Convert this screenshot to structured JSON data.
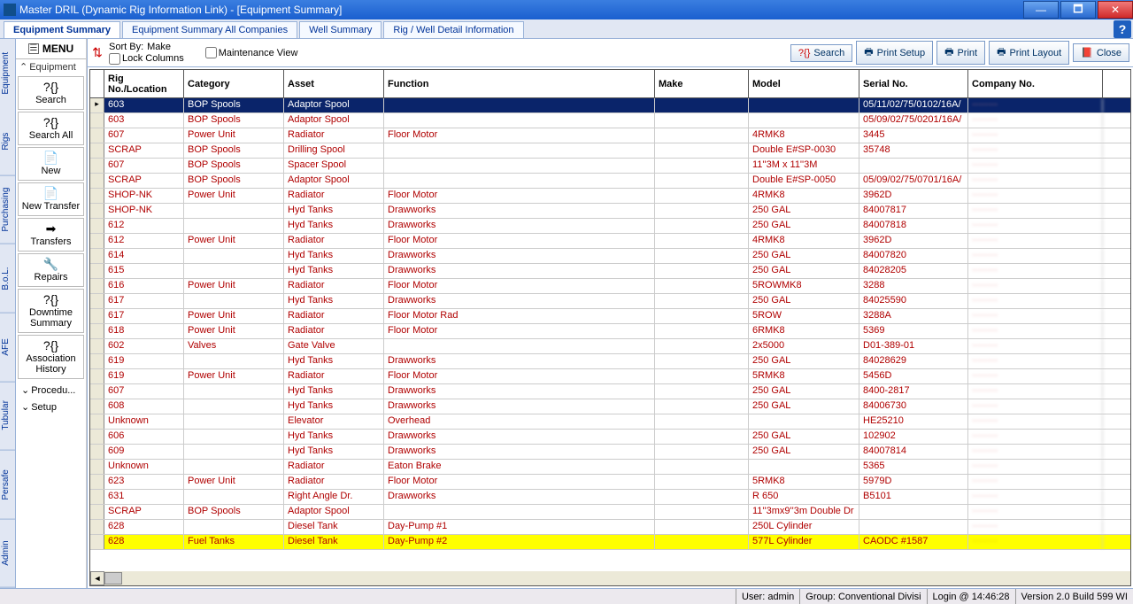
{
  "window": {
    "title": "Master DRIL (Dynamic Rig Information Link) - [Equipment Summary]"
  },
  "tabs": [
    {
      "label": "Equipment Summary",
      "active": true
    },
    {
      "label": "Equipment Summary All Companies"
    },
    {
      "label": "Well Summary"
    },
    {
      "label": "Rig / Well Detail Information"
    }
  ],
  "side_tabs": [
    "Equipment",
    "Rigs",
    "Purchasing",
    "B.o.L.",
    "AFE",
    "Tubular",
    "Persafe",
    "Admin"
  ],
  "menu": {
    "title": "MENU",
    "section": "Equipment",
    "items": [
      {
        "label": "Search",
        "icon": "?{}"
      },
      {
        "label": "Search All",
        "icon": "?{}"
      },
      {
        "label": "New",
        "icon": "📄"
      },
      {
        "label": "New Transfer",
        "icon": "📄"
      },
      {
        "label": "Transfers",
        "icon": "➡"
      },
      {
        "label": "Repairs",
        "icon": "🔧"
      },
      {
        "label": "Downtime Summary",
        "icon": "?{}"
      },
      {
        "label": "Association History",
        "icon": "?{}"
      }
    ],
    "collapsed": [
      {
        "label": "Procedu..."
      },
      {
        "label": "Setup"
      }
    ]
  },
  "toolbar": {
    "sort_by_label": "Sort By:",
    "sort_by_value": "Make",
    "lock_columns": "Lock Columns",
    "maintenance_view": "Maintenance View",
    "search": "Search",
    "print_setup": "Print Setup",
    "print": "Print",
    "print_layout": "Print Layout",
    "close": "Close"
  },
  "grid": {
    "columns": [
      "Rig No./Location",
      "Category",
      "Asset",
      "Function",
      "Make",
      "Model",
      "Serial No.",
      "Company No."
    ],
    "rows": [
      {
        "sel": true,
        "cells": [
          "603",
          "BOP Spools",
          "Adaptor Spool",
          "",
          "",
          "",
          "05/11/02/75/0102/16A/",
          ""
        ]
      },
      {
        "cells": [
          "603",
          "BOP Spools",
          "Adaptor Spool",
          "",
          "",
          "",
          "05/09/02/75/0201/16A/",
          ""
        ]
      },
      {
        "cells": [
          "607",
          "Power Unit",
          "Radiator",
          "Floor Motor",
          "",
          "4RMK8",
          "3445",
          ""
        ]
      },
      {
        "cells": [
          "SCRAP",
          "BOP Spools",
          "Drilling Spool",
          "",
          "",
          "Double E#SP-0030",
          "35748",
          ""
        ]
      },
      {
        "cells": [
          "607",
          "BOP Spools",
          "Spacer Spool",
          "",
          "",
          "11''3M x 11''3M",
          "",
          ""
        ]
      },
      {
        "cells": [
          "SCRAP",
          "BOP Spools",
          "Adaptor Spool",
          "",
          "",
          "Double E#SP-0050",
          "05/09/02/75/0701/16A/",
          ""
        ]
      },
      {
        "cells": [
          "SHOP-NK",
          "Power Unit",
          "Radiator",
          "Floor Motor",
          "",
          "4RMK8",
          "3962D",
          ""
        ]
      },
      {
        "cells": [
          "SHOP-NK",
          "",
          "Hyd Tanks",
          "Drawworks",
          "",
          "250 GAL",
          "84007817",
          ""
        ]
      },
      {
        "cells": [
          "612",
          "",
          "Hyd Tanks",
          "Drawworks",
          "",
          "250 GAL",
          "84007818",
          ""
        ]
      },
      {
        "cells": [
          "612",
          "Power Unit",
          "Radiator",
          "Floor Motor",
          "",
          "4RMK8",
          "3962D",
          ""
        ]
      },
      {
        "cells": [
          "614",
          "",
          "Hyd Tanks",
          "Drawworks",
          "",
          "250 GAL",
          "84007820",
          ""
        ]
      },
      {
        "cells": [
          "615",
          "",
          "Hyd Tanks",
          "Drawworks",
          "",
          "250 GAL",
          "84028205",
          ""
        ]
      },
      {
        "cells": [
          "616",
          "Power Unit",
          "Radiator",
          "Floor Motor",
          "",
          "5ROWMK8",
          "3288",
          ""
        ]
      },
      {
        "cells": [
          "617",
          "",
          "Hyd Tanks",
          "Drawworks",
          "",
          "250 GAL",
          "84025590",
          ""
        ]
      },
      {
        "cells": [
          "617",
          "Power Unit",
          "Radiator",
          "Floor Motor Rad",
          "",
          "5ROW",
          "3288A",
          ""
        ]
      },
      {
        "cells": [
          "618",
          "Power Unit",
          "Radiator",
          "Floor Motor",
          "",
          "6RMK8",
          "5369",
          ""
        ]
      },
      {
        "cells": [
          "602",
          "Valves",
          "Gate Valve",
          "",
          "",
          "2x5000",
          "D01-389-01",
          ""
        ]
      },
      {
        "cells": [
          "619",
          "",
          "Hyd Tanks",
          "Drawworks",
          "",
          "250 GAL",
          "84028629",
          ""
        ]
      },
      {
        "cells": [
          "619",
          "Power Unit",
          "Radiator",
          "Floor Motor",
          "",
          "5RMK8",
          "5456D",
          ""
        ]
      },
      {
        "cells": [
          "607",
          "",
          "Hyd Tanks",
          "Drawworks",
          "",
          "250 GAL",
          "8400-2817",
          ""
        ]
      },
      {
        "cells": [
          "608",
          "",
          "Hyd Tanks",
          "Drawworks",
          "",
          "250 GAL",
          "84006730",
          ""
        ]
      },
      {
        "cells": [
          "Unknown",
          "",
          "Elevator",
          "Overhead",
          "",
          "",
          "HE25210",
          ""
        ]
      },
      {
        "cells": [
          "606",
          "",
          "Hyd Tanks",
          "Drawworks",
          "",
          "250 GAL",
          "102902",
          ""
        ]
      },
      {
        "cells": [
          "609",
          "",
          "Hyd Tanks",
          "Drawworks",
          "",
          "250 GAL",
          "84007814",
          ""
        ]
      },
      {
        "cells": [
          "Unknown",
          "",
          "Radiator",
          "Eaton Brake",
          "",
          "",
          "5365",
          ""
        ]
      },
      {
        "cells": [
          "623",
          "Power Unit",
          "Radiator",
          "Floor Motor",
          "",
          "5RMK8",
          "5979D",
          ""
        ]
      },
      {
        "cells": [
          "631",
          "",
          "Right Angle Dr.",
          "Drawworks",
          "",
          "R 650",
          "B5101",
          ""
        ]
      },
      {
        "cells": [
          "SCRAP",
          "BOP Spools",
          "Adaptor Spool",
          "",
          "",
          "11''3mx9''3m Double Dr",
          "",
          ""
        ]
      },
      {
        "cells": [
          "628",
          "",
          "Diesel Tank",
          "Day-Pump #1",
          "",
          "250L Cylinder",
          "",
          ""
        ]
      },
      {
        "hl": true,
        "cells": [
          "628",
          "Fuel Tanks",
          "Diesel Tank",
          "Day-Pump #2",
          "",
          "577L Cylinder",
          "CAODC #1587",
          ""
        ]
      }
    ]
  },
  "statusbar": {
    "user": "User: admin",
    "group": "Group: Conventional Divisi",
    "login": "Login @ 14:46:28",
    "version": "Version 2.0 Build 599 WI"
  }
}
